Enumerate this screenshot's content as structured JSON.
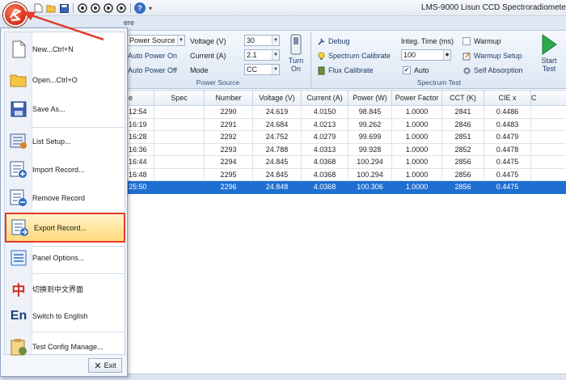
{
  "window": {
    "title": "LMS-9000 Lisun CCD Spectroradiomete"
  },
  "tabs": {
    "home_label": "ere"
  },
  "ribbon": {
    "power_source_group": {
      "label": "Power Source",
      "power_source_combo": "Power Source",
      "auto_power_on": "Auto Power On",
      "auto_power_off": "Auto Power Off",
      "voltage_label": "Voltage (V)",
      "voltage_value": "30",
      "current_label": "Current (A)",
      "current_value": "2.1",
      "mode_label": "Mode",
      "mode_value": "CC",
      "turn_on_line1": "Turn",
      "turn_on_line2": "On"
    },
    "spectrum_group": {
      "label": "Spectrum Test",
      "debug": "Debug",
      "spectrum_calibrate": "Spectrum Calibrate",
      "flux_calibrate": "Flux Calibrate",
      "integ_time_label": "Integ. Time (ms)",
      "integ_time_value": "100",
      "auto_label": "Auto",
      "warmup": "Warmup",
      "warmup_setup": "Warmup Setup",
      "self_absorption": "Self Absorption",
      "start_test_line1": "Start",
      "start_test_line2": "Test"
    }
  },
  "table": {
    "headers": [
      "e",
      "Spec",
      "Number",
      "Voltage (V)",
      "Current (A)",
      "Power (W)",
      "Power Factor",
      "CCT (K)",
      "CIE x",
      "C"
    ],
    "rows": [
      [
        "12:54",
        "",
        "2290",
        "24.619",
        "4.0150",
        "98.845",
        "1.0000",
        "2841",
        "0.4486",
        ""
      ],
      [
        "16:19",
        "",
        "2291",
        "24.684",
        "4.0213",
        "99.262",
        "1.0000",
        "2846",
        "0.4483",
        ""
      ],
      [
        "16:28",
        "",
        "2292",
        "24.752",
        "4.0279",
        "99.699",
        "1.0000",
        "2851",
        "0.4479",
        ""
      ],
      [
        "16:36",
        "",
        "2293",
        "24.788",
        "4.0313",
        "99.928",
        "1.0000",
        "2852",
        "0.4478",
        ""
      ],
      [
        "16:44",
        "",
        "2294",
        "24.845",
        "4.0368",
        "100.294",
        "1.0000",
        "2856",
        "0.4475",
        ""
      ],
      [
        "16:48",
        "",
        "2295",
        "24.845",
        "4.0368",
        "100.294",
        "1.0000",
        "2856",
        "0.4475",
        ""
      ],
      [
        "25:50",
        "",
        "2296",
        "24.848",
        "4.0368",
        "100.306",
        "1.0000",
        "2856",
        "0.4475",
        ""
      ]
    ],
    "selected_row": 6
  },
  "app_menu": {
    "items": [
      {
        "label": "New...Ctrl+N",
        "icon": "new-file-icon"
      },
      {
        "label": "Open...Ctrl+O",
        "icon": "open-folder-icon"
      },
      {
        "label": "Save As...",
        "icon": "save-icon"
      },
      {
        "label": "List Setup...",
        "icon": "list-setup-icon"
      },
      {
        "label": "Import Record...",
        "icon": "import-record-icon"
      },
      {
        "label": "Remove Record",
        "icon": "remove-record-icon"
      },
      {
        "label": "Export Record...",
        "icon": "export-record-icon"
      },
      {
        "label": "Panel Options...",
        "icon": "panel-options-icon"
      },
      {
        "label": "切换到中文界面",
        "icon": "chinese-language-icon"
      },
      {
        "label": "Switch to English",
        "icon": "english-language-icon"
      },
      {
        "label": "Test Config Manage...",
        "icon": "config-manage-icon"
      }
    ],
    "exit_label": "Exit"
  },
  "colors": {
    "selection": "#1f6fd0",
    "highlight_border": "#e23b2a",
    "arrow": "#e23b2a",
    "ribbon_bg": "#dde7f3"
  }
}
